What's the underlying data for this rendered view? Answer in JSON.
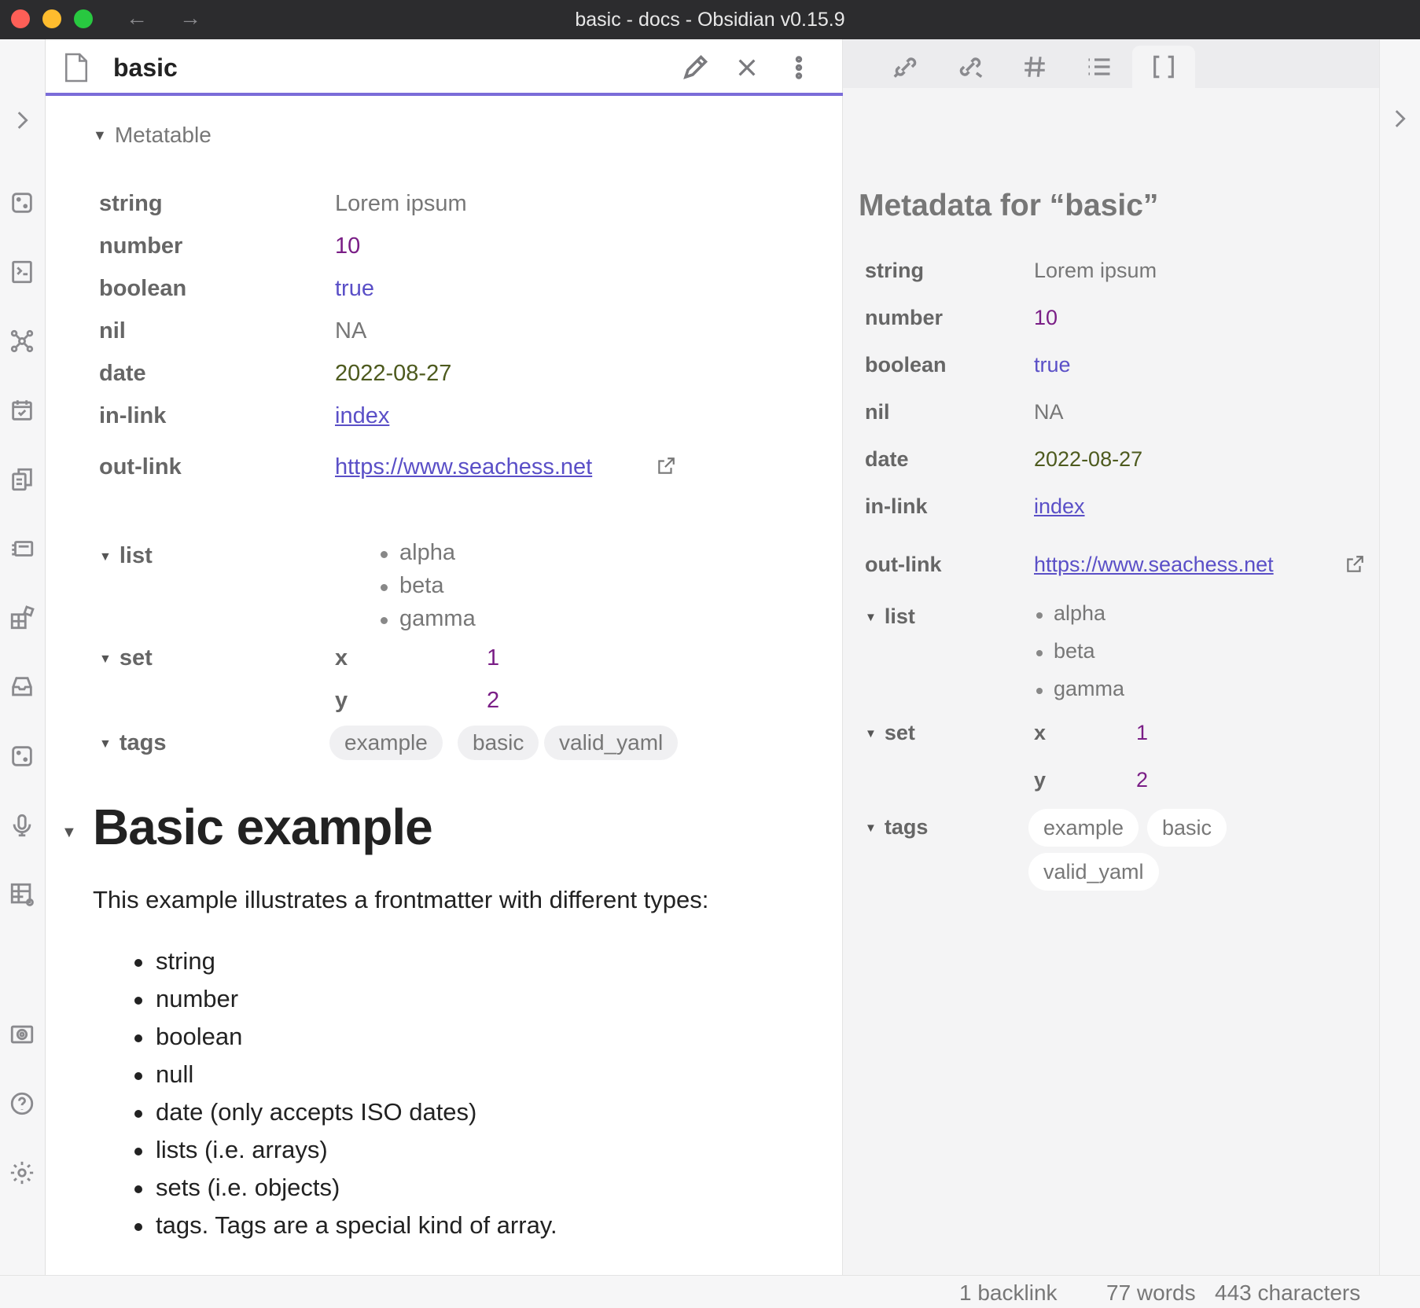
{
  "window": {
    "title": "basic - docs - Obsidian v0.15.9"
  },
  "tab": {
    "title": "basic"
  },
  "metatable": {
    "summary": "Metatable",
    "rows": {
      "string": {
        "key": "string",
        "value": "Lorem ipsum"
      },
      "number": {
        "key": "number",
        "value": "10"
      },
      "boolean": {
        "key": "boolean",
        "value": "true"
      },
      "nil": {
        "key": "nil",
        "value": "NA"
      },
      "date": {
        "key": "date",
        "value": "2022-08-27"
      },
      "inlink": {
        "key": "in-link",
        "value": "index"
      },
      "outlink": {
        "key": "out-link",
        "value": "https://www.seachess.net"
      },
      "list": {
        "key": "list",
        "items": [
          "alpha",
          "beta",
          "gamma"
        ]
      },
      "set": {
        "key": "set",
        "entries": [
          {
            "k": "x",
            "v": "1"
          },
          {
            "k": "y",
            "v": "2"
          }
        ]
      },
      "tags": {
        "key": "tags",
        "items": [
          "example",
          "basic",
          "valid_yaml"
        ]
      }
    }
  },
  "document": {
    "heading": "Basic example",
    "paragraph": "This example illustrates a frontmatter with different types:",
    "list": [
      "string",
      "number",
      "boolean",
      "null",
      "date (only accepts ISO dates)",
      "lists (i.e. arrays)",
      "sets (i.e. objects)",
      "tags. Tags are a special kind of array."
    ]
  },
  "sidebar": {
    "title": "Metadata for “basic”"
  },
  "status": {
    "backlinks": "1 backlink",
    "words": "77 words",
    "characters": "443 characters"
  },
  "colors": {
    "accent": "#7b6cd9",
    "number": "#7a1e86",
    "boolean": "#5a4fc7",
    "date": "#4d5a1e",
    "link": "#5a4fc7"
  },
  "icons": {
    "ribbon": [
      "chevron-right-icon",
      "dice-icon",
      "command-palette-icon",
      "graph-icon",
      "calendar-check-icon",
      "copy-files-icon",
      "slides-icon",
      "kanban-icon",
      "inbox-icon",
      "dice-icon",
      "microphone-icon",
      "table-settings-icon",
      "vault-icon",
      "help-icon",
      "settings-icon"
    ],
    "sidebar_tabs": [
      "backlinks-icon",
      "outgoing-links-icon",
      "tags-icon",
      "outline-icon",
      "metadata-icon"
    ]
  }
}
